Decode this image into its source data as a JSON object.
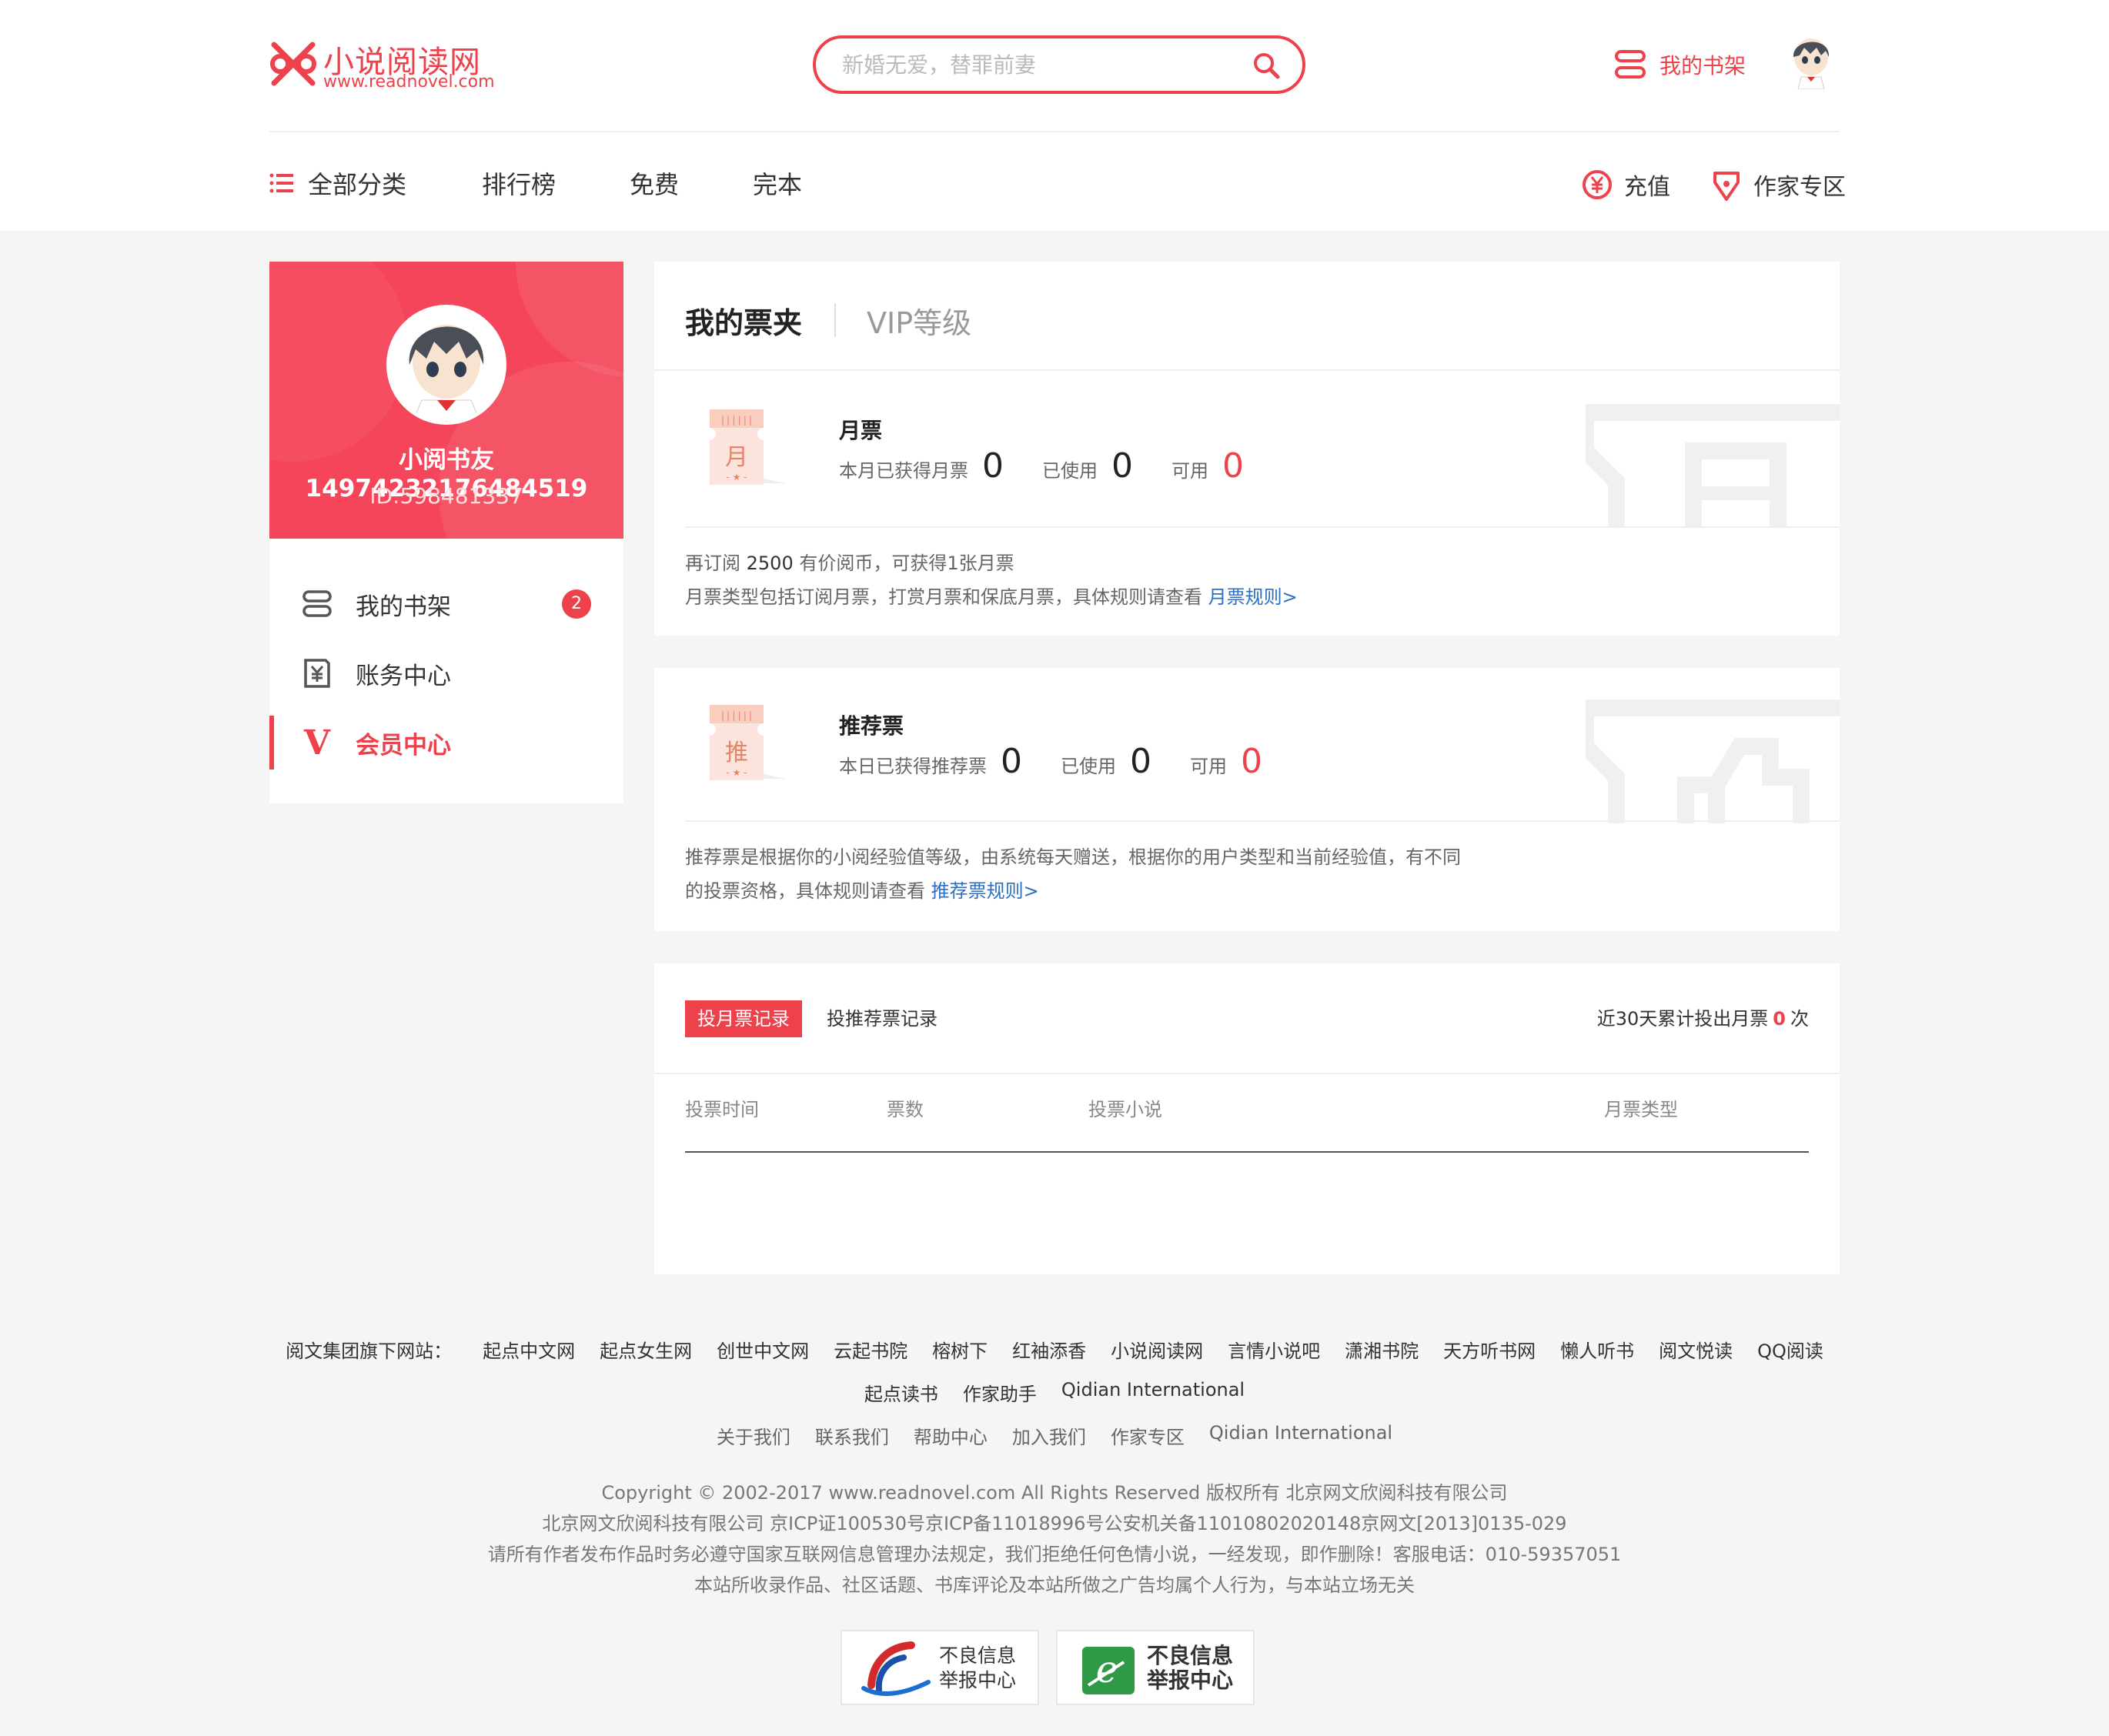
{
  "header": {
    "logo_title": "小说阅读网",
    "logo_url": "www.readnovel.com",
    "search_placeholder": "新婚无爱，替罪前妻",
    "shelf_label": "我的书架"
  },
  "nav": {
    "items": [
      "全部分类",
      "排行榜",
      "免费",
      "完本"
    ],
    "recharge": "充值",
    "author_zone": "作家专区"
  },
  "profile": {
    "name": "小阅书友14974232176484519",
    "id": "ID:598481337"
  },
  "sidebar": {
    "items": [
      {
        "label": "我的书架",
        "badge": "2"
      },
      {
        "label": "账务中心"
      },
      {
        "label": "会员中心",
        "icon_text": "V"
      }
    ]
  },
  "tickets": {
    "tabs": [
      "我的票夹",
      "VIP等级"
    ],
    "monthly": {
      "icon_text": "月",
      "title": "月票",
      "earned_label": "本月已获得月票",
      "earned": "0",
      "used_label": "已使用",
      "used": "0",
      "avail_label": "可用",
      "avail": "0",
      "desc1_pre": "再订阅",
      "desc1_num": "2500",
      "desc1_post": "有价阅币，可获得1张月票",
      "desc2": "月票类型包括订阅月票，打赏月票和保底月票，具体规则请查看",
      "rule_link": "月票规则>"
    },
    "recommend": {
      "icon_text": "推",
      "title": "推荐票",
      "earned_label": "本日已获得推荐票",
      "earned": "0",
      "used_label": "已使用",
      "used": "0",
      "avail_label": "可用",
      "avail": "0",
      "desc1": "推荐票是根据你的小阅经验值等级，由系统每天赠送，根据你的用户类型和当前经验值，有不同",
      "desc2": "的投票资格，具体规则请查看",
      "rule_link": "推荐票规则>"
    }
  },
  "records": {
    "tab_active": "投月票记录",
    "tab_other": "投推荐票记录",
    "summary_pre": "近30天累计投出月票",
    "summary_num": "0",
    "summary_post": "次",
    "columns": [
      "投票时间",
      "票数",
      "投票小说",
      "月票类型"
    ]
  },
  "footer": {
    "sites_label": "阅文集团旗下网站：",
    "sites": [
      "起点中文网",
      "起点女生网",
      "创世中文网",
      "云起书院",
      "榕树下",
      "红袖添香",
      "小说阅读网",
      "言情小说吧",
      "潇湘书院",
      "天方听书网",
      "懒人听书",
      "阅文悦读",
      "QQ阅读"
    ],
    "sites2": [
      "起点读书",
      "作家助手",
      "Qidian International"
    ],
    "links": [
      "关于我们",
      "联系我们",
      "帮助中心",
      "加入我们",
      "作家专区",
      "Qidian International"
    ],
    "copy1": "Copyright © 2002-2017 www.readnovel.com All Rights Reserved 版权所有 北京网文欣阅科技有限公司",
    "copy2": "北京网文欣阅科技有限公司 京ICP证100530号京ICP备11018996号公安机关备11010802020148京网文[2013]0135-029",
    "copy3": "请所有作者发布作品时务必遵守国家互联网信息管理办法规定，我们拒绝任何色情小说，一经发现，即作删除！客服电话：010-59357051",
    "copy4": "本站所收录作品、社区话题、书库评论及本站所做之广告均属个人行为，与本站立场无关",
    "badge1": [
      "不良信息",
      "举报中心"
    ],
    "badge2": [
      "不良信息",
      "举报中心"
    ]
  }
}
